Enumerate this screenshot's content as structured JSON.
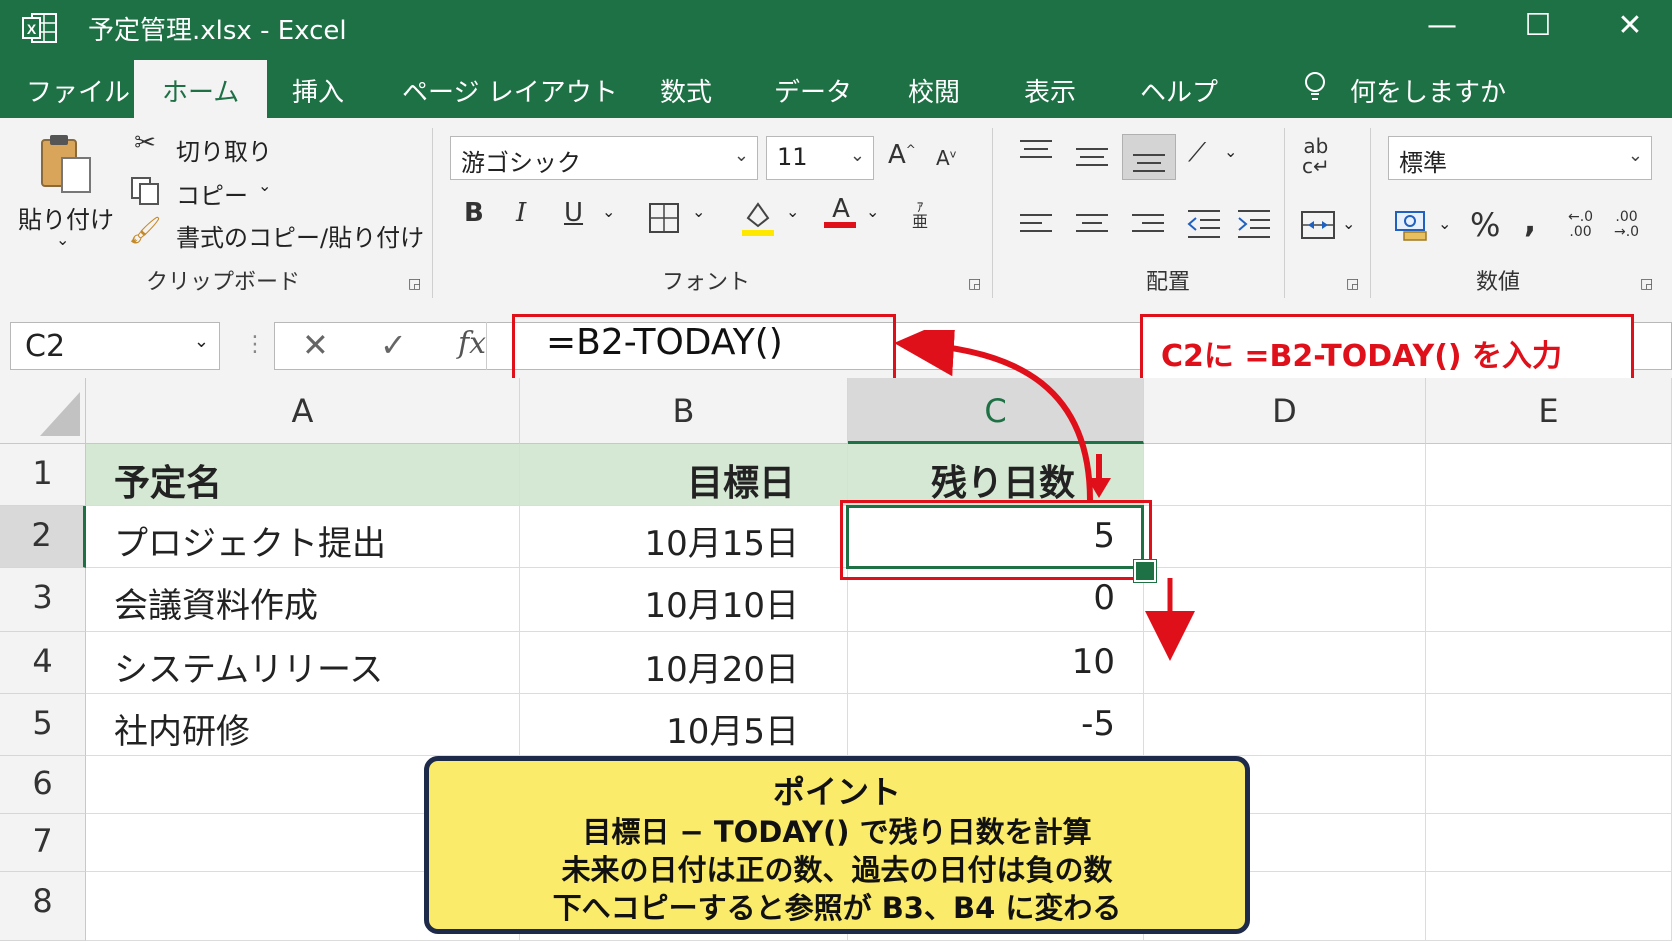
{
  "window": {
    "title": "予定管理.xlsx  -  Excel",
    "controls": [
      "minimize-icon",
      "maximize-icon",
      "close-icon"
    ]
  },
  "menu": {
    "tabs": [
      "ファイル",
      "ホーム",
      "挿入",
      "ページ レイアウト",
      "数式",
      "データ",
      "校閲",
      "表示",
      "ヘルプ"
    ],
    "active": "ホーム",
    "tell_me": "何をしますか"
  },
  "ribbon": {
    "clipboard": {
      "paste": "貼り付け",
      "cut": "切り取り",
      "copy": "コピー",
      "format_painter": "書式のコピー/貼り付け",
      "group": "クリップボード"
    },
    "font": {
      "name": "游ゴシック",
      "size": "11",
      "bold": "B",
      "italic": "I",
      "underline": "U",
      "font_color_letter": "A",
      "grow": "A",
      "shrink": "A",
      "group": "フォント"
    },
    "alignment": {
      "group": "配置"
    },
    "number": {
      "format": "標準",
      "percent": "%",
      "comma": ",",
      "group": "数値"
    }
  },
  "formula_bar": {
    "name_box": "C2",
    "formula": "=B2-TODAY()",
    "callout": "C2に  =B2-TODAY() を入力"
  },
  "sheet": {
    "columns": [
      "A",
      "B",
      "C",
      "D",
      "E"
    ],
    "selected_column": "C",
    "rows": [
      "1",
      "2",
      "3",
      "4",
      "5",
      "6",
      "7",
      "8"
    ],
    "selected_row": "2",
    "headers": [
      "予定名",
      "目標日",
      "残り日数"
    ],
    "data": [
      [
        "プロジェクト提出",
        "10月15日",
        "5"
      ],
      [
        "会議資料作成",
        "10月10日",
        "0"
      ],
      [
        "システムリリース",
        "10月20日",
        "10"
      ],
      [
        "社内研修",
        "10月5日",
        "-5"
      ]
    ],
    "header_fill": "#d5e8d4",
    "selection_color": "#1e7145"
  },
  "point": {
    "title": "ポイント",
    "lines": [
      "目標日 − TODAY() で残り日数を計算",
      "未来の日付は正の数、過去の日付は負の数",
      "下へコピーすると参照が B3、B4 に変わる"
    ]
  },
  "colors": {
    "excel_green": "#1e7145",
    "callout_red": "#e0101a",
    "point_fill": "#fbeb6b"
  }
}
